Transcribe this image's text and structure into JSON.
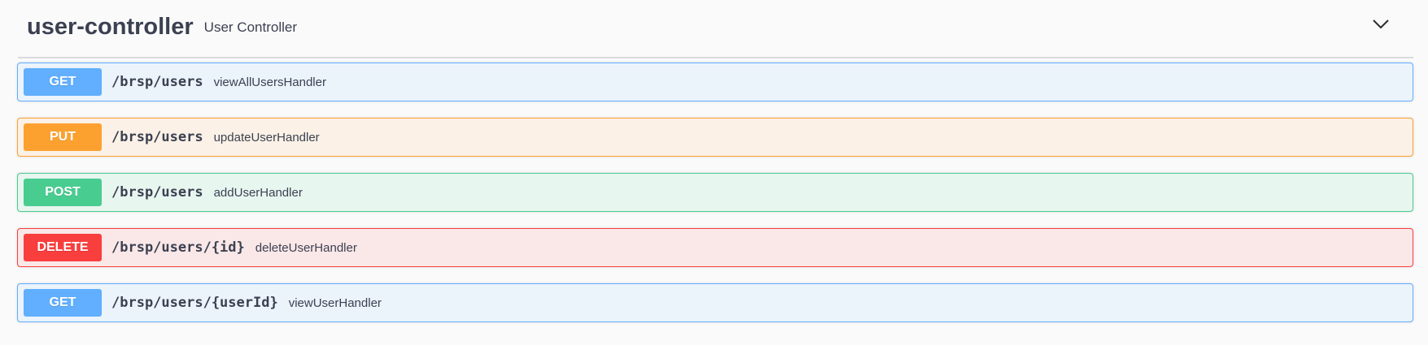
{
  "tag": {
    "name": "user-controller",
    "description": "User Controller",
    "expand_icon": "chevron-down-icon"
  },
  "operations": [
    {
      "method": "GET",
      "path": "/brsp/users",
      "summary": "viewAllUsersHandler",
      "color": "#61affe",
      "bg": "#ebf3fb",
      "border": "#61affe"
    },
    {
      "method": "PUT",
      "path": "/brsp/users",
      "summary": "updateUserHandler",
      "color": "#fca130",
      "bg": "#fbf1e6",
      "border": "#fca130"
    },
    {
      "method": "POST",
      "path": "/brsp/users",
      "summary": "addUserHandler",
      "color": "#49cc90",
      "bg": "#e8f6f0",
      "border": "#49cc90"
    },
    {
      "method": "DELETE",
      "path": "/brsp/users/{id}",
      "summary": "deleteUserHandler",
      "color": "#f93e3e",
      "bg": "#fae7e7",
      "border": "#f93e3e"
    },
    {
      "method": "GET",
      "path": "/brsp/users/{userId}",
      "summary": "viewUserHandler",
      "color": "#61affe",
      "bg": "#ebf3fb",
      "border": "#61affe"
    }
  ]
}
